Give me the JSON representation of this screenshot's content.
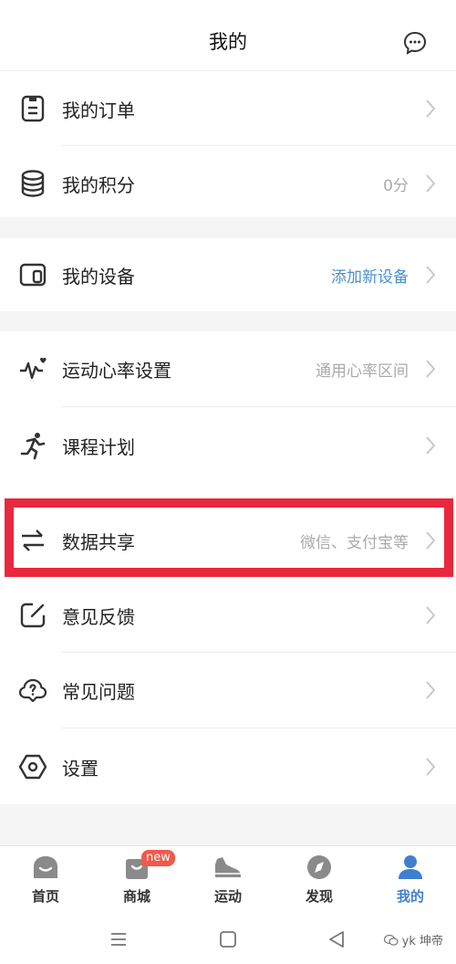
{
  "header": {
    "title": "我的",
    "chat_icon": "chat-bubble-icon"
  },
  "group1": {
    "items": [
      {
        "label": "我的订单",
        "value": "",
        "icon": "order-icon"
      },
      {
        "label": "我的积分",
        "value": "0分",
        "icon": "coins-icon"
      }
    ]
  },
  "group2": {
    "items": [
      {
        "label": "我的设备",
        "value": "添加新设备",
        "icon": "device-icon"
      }
    ]
  },
  "group3": {
    "items": [
      {
        "label": "运动心率设置",
        "value": "通用心率区间",
        "icon": "heartrate-icon"
      },
      {
        "label": "课程计划",
        "value": "",
        "icon": "running-icon"
      },
      {
        "label": "数据共享",
        "value": "微信、支付宝等",
        "icon": "share-arrows-icon"
      },
      {
        "label": "意见反馈",
        "value": "",
        "icon": "feedback-icon"
      },
      {
        "label": "常见问题",
        "value": "",
        "icon": "faq-icon"
      },
      {
        "label": "设置",
        "value": "",
        "icon": "settings-icon"
      }
    ]
  },
  "tabbar": {
    "tabs": [
      {
        "label": "首页",
        "icon": "home-icon"
      },
      {
        "label": "商城",
        "icon": "shop-bag-icon",
        "badge": "new"
      },
      {
        "label": "运动",
        "icon": "shoe-icon"
      },
      {
        "label": "发现",
        "icon": "compass-icon"
      },
      {
        "label": "我的",
        "icon": "profile-icon",
        "active": true
      }
    ]
  },
  "colors": {
    "accent": "#3f7fd0",
    "highlight": "#e8283d",
    "badge": "#f05a4a"
  },
  "watermark": "yk 坤帝"
}
